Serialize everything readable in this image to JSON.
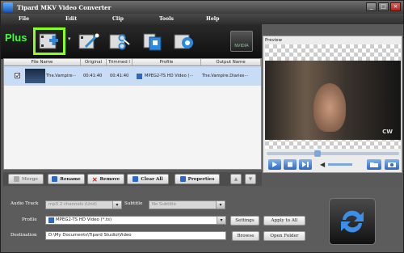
{
  "window": {
    "title": "Tipard MKV Video Converter",
    "controls": [
      "_",
      "□",
      "×"
    ]
  },
  "menu": [
    "File",
    "Edit",
    "Clip",
    "Tools",
    "Help"
  ],
  "toolbar": {
    "callout": "Plus",
    "buttons": [
      "add-file",
      "edit-video",
      "clip",
      "merge",
      "settings"
    ],
    "hardware_badge": "NVIDIA"
  },
  "file_list": {
    "columns": [
      "File Name",
      "Original",
      "Trimmed l",
      "Profile",
      "Output Name"
    ],
    "rows": [
      {
        "checked": true,
        "file_name": "The.Vampire···",
        "original": "00:41:40",
        "trimmed": "00:41:40",
        "profile": "MPEG2-TS HD Video (···",
        "output_name": "The.Vampire.Diaries···"
      }
    ]
  },
  "list_buttons": {
    "merge": "Merge",
    "rename": "Rename",
    "remove": "Remove",
    "clear_all": "Clear All",
    "properties": "Properties"
  },
  "preview": {
    "label": "Preview",
    "watermark": "CW",
    "progress": 0.38
  },
  "bottom": {
    "audio_track_label": "Audio Track",
    "audio_track_value": "mp3 2 channels (Und)",
    "subtitle_label": "Subtitle",
    "subtitle_value": "No Subtitle",
    "profile_label": "Profile",
    "profile_value": "MPEG2-TS HD Video (*.ts)",
    "destination_label": "Destination",
    "destination_value": "D:\\My Documents\\Tipard Studio\\Video",
    "settings": "Settings",
    "apply_to_all": "Apply to All",
    "browse": "Browse",
    "open_folder": "Open Folder"
  },
  "colors": {
    "highlight": "#8cff1a",
    "selection": "#c9dcf6",
    "accent": "#2d68c4"
  }
}
